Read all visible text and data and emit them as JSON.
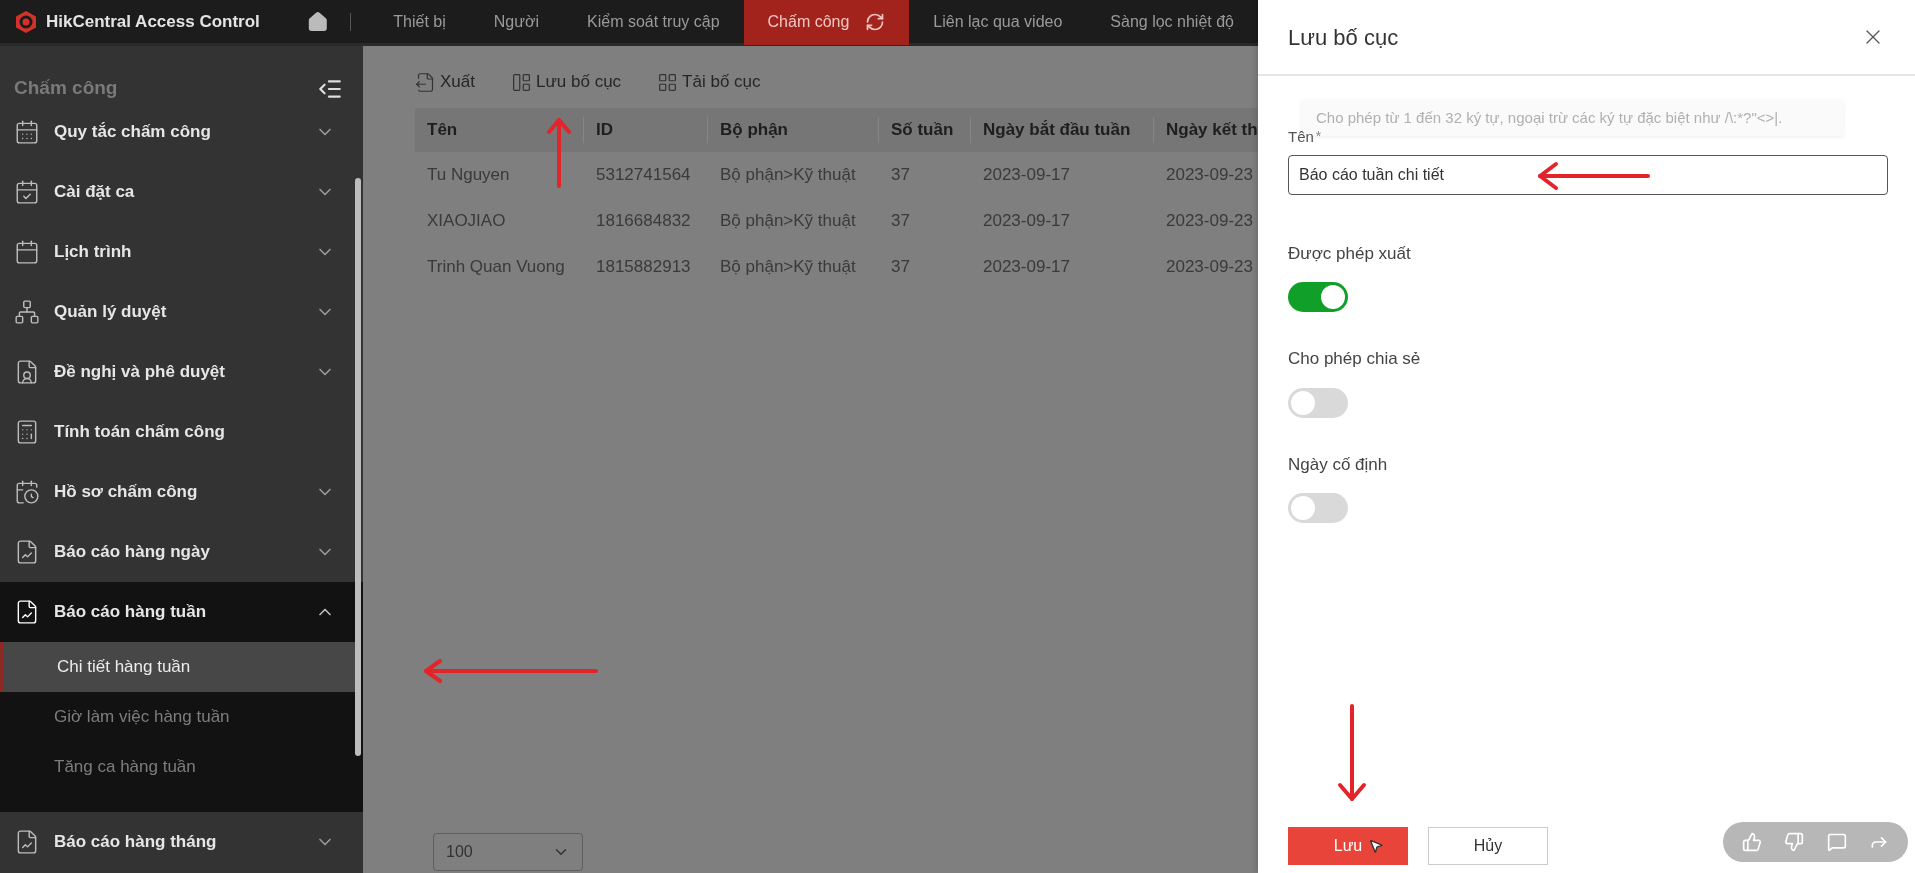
{
  "app": {
    "title": "HikCentral Access Control"
  },
  "nav_tabs": [
    {
      "label": "Thiết bị",
      "selected": false
    },
    {
      "label": "Người",
      "selected": false
    },
    {
      "label": "Kiểm soát truy cập",
      "selected": false
    },
    {
      "label": "Chấm công",
      "selected": true
    },
    {
      "label": "Liên lạc qua video",
      "selected": false
    },
    {
      "label": "Sàng lọc nhiệt độ",
      "selected": false
    }
  ],
  "sidebar": {
    "title": "Chấm công",
    "items": [
      {
        "label": "Quy tắc chấm công",
        "kind": "group",
        "expanded": false
      },
      {
        "label": "Cài đặt ca",
        "kind": "group",
        "expanded": false
      },
      {
        "label": "Lịch trình",
        "kind": "group",
        "expanded": false
      },
      {
        "label": "Quản lý duyệt",
        "kind": "group",
        "expanded": false
      },
      {
        "label": "Đề nghị và phê duyệt",
        "kind": "group",
        "expanded": false
      },
      {
        "label": "Tính toán chấm công",
        "kind": "link"
      },
      {
        "label": "Hồ sơ chấm công",
        "kind": "group",
        "expanded": false
      },
      {
        "label": "Báo cáo hàng ngày",
        "kind": "group",
        "expanded": false
      },
      {
        "label": "Báo cáo hàng tuần",
        "kind": "group",
        "expanded": true,
        "children": [
          {
            "label": "Chi tiết hàng tuần",
            "selected": true
          },
          {
            "label": "Giờ làm việc hàng tuần",
            "selected": false
          },
          {
            "label": "Tăng ca hàng tuần",
            "selected": false
          }
        ]
      },
      {
        "label": "Báo cáo hàng tháng",
        "kind": "group",
        "expanded": false
      }
    ]
  },
  "toolbar": [
    "Xuất",
    "Lưu bố cục",
    "Tải bố cục"
  ],
  "table": {
    "columns": [
      "Tên",
      "ID",
      "Bộ phận",
      "Số tuần",
      "Ngày bắt đầu tuần",
      "Ngày kết th"
    ],
    "rows": [
      [
        "Tu Nguyen",
        "5312741564",
        "Bộ phận>Kỹ thuật",
        "37",
        "2023-09-17",
        "2023-09-23"
      ],
      [
        "XIAOJIAO",
        "1816684832",
        "Bộ phận>Kỹ thuật",
        "37",
        "2023-09-17",
        "2023-09-23"
      ],
      [
        "Trinh Quan Vuong",
        "1815882913",
        "Bộ phận>Kỹ thuật",
        "37",
        "2023-09-17",
        "2023-09-23"
      ]
    ]
  },
  "page_size": {
    "value": "100"
  },
  "dialog": {
    "title": "Lưu bố cục",
    "tooltip": "Cho phép từ 1 đến 32 ký tự, ngoại trừ các ký tự đặc biệt như /\\:*?\"<>|.",
    "name_field": {
      "label": "Tên",
      "required_mark": "*",
      "value": "Báo cáo tuần chi tiết"
    },
    "toggles": [
      {
        "label": "Được phép xuất",
        "on": true
      },
      {
        "label": "Cho phép chia sẻ",
        "on": false
      },
      {
        "label": "Ngày cố định",
        "on": false
      }
    ],
    "buttons": [
      {
        "label": "Lưu",
        "kind": "primary"
      },
      {
        "label": "Hủy",
        "kind": "secondary"
      }
    ]
  }
}
